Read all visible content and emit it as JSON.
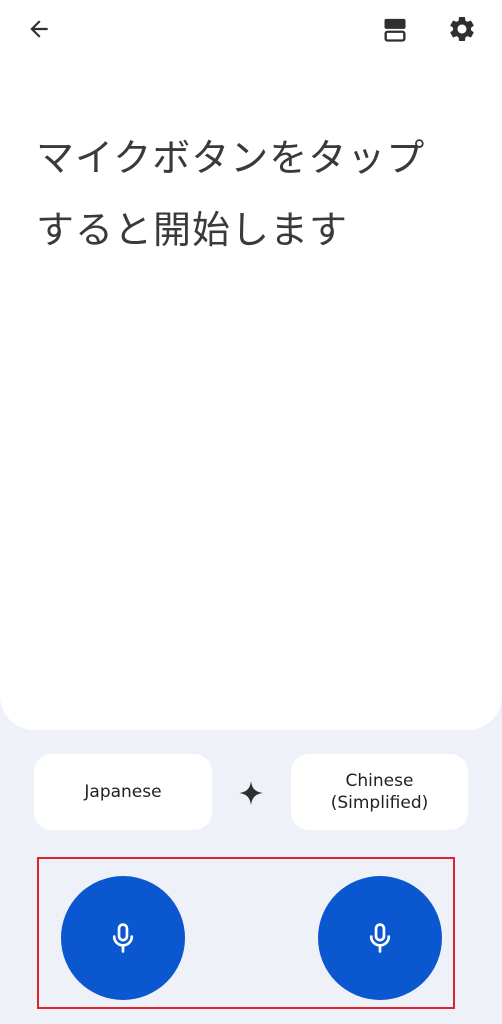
{
  "toolbar": {
    "back_icon": "arrow-back-icon",
    "layout_icon": "split-view-icon",
    "settings_icon": "gear-icon"
  },
  "main": {
    "prompt": "マイクボタンをタップすると開始します"
  },
  "languages": {
    "left": "Japanese",
    "right": "Chinese\n(Simplified)",
    "swap_icon": "sparkle-icon"
  },
  "mics": {
    "left_icon": "microphone-icon",
    "right_icon": "microphone-icon"
  },
  "colors": {
    "background": "#eef1f7",
    "card": "#ffffff",
    "mic_button": "#0b57d0",
    "highlight_border": "#e0242c",
    "text": "#3a3a3a"
  }
}
